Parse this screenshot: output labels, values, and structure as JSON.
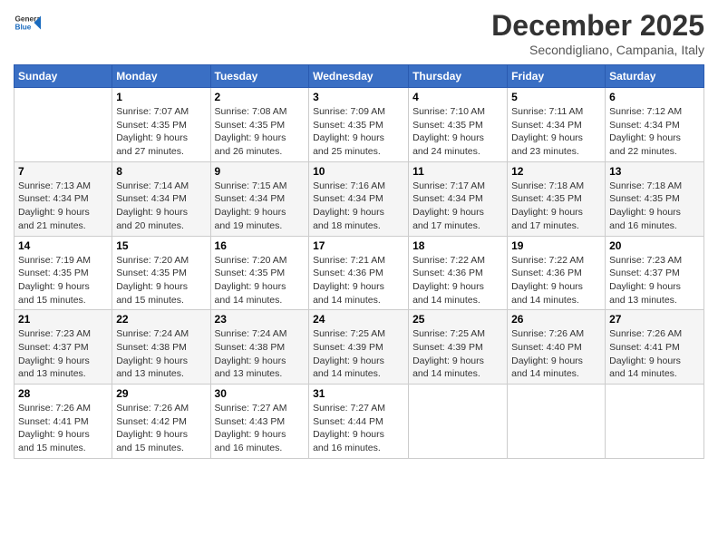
{
  "logo": {
    "general": "General",
    "blue": "Blue"
  },
  "header": {
    "month": "December 2025",
    "location": "Secondigliano, Campania, Italy"
  },
  "weekdays": [
    "Sunday",
    "Monday",
    "Tuesday",
    "Wednesday",
    "Thursday",
    "Friday",
    "Saturday"
  ],
  "weeks": [
    [
      {
        "day": "",
        "info": ""
      },
      {
        "day": "1",
        "info": "Sunrise: 7:07 AM\nSunset: 4:35 PM\nDaylight: 9 hours\nand 27 minutes."
      },
      {
        "day": "2",
        "info": "Sunrise: 7:08 AM\nSunset: 4:35 PM\nDaylight: 9 hours\nand 26 minutes."
      },
      {
        "day": "3",
        "info": "Sunrise: 7:09 AM\nSunset: 4:35 PM\nDaylight: 9 hours\nand 25 minutes."
      },
      {
        "day": "4",
        "info": "Sunrise: 7:10 AM\nSunset: 4:35 PM\nDaylight: 9 hours\nand 24 minutes."
      },
      {
        "day": "5",
        "info": "Sunrise: 7:11 AM\nSunset: 4:34 PM\nDaylight: 9 hours\nand 23 minutes."
      },
      {
        "day": "6",
        "info": "Sunrise: 7:12 AM\nSunset: 4:34 PM\nDaylight: 9 hours\nand 22 minutes."
      }
    ],
    [
      {
        "day": "7",
        "info": "Sunrise: 7:13 AM\nSunset: 4:34 PM\nDaylight: 9 hours\nand 21 minutes."
      },
      {
        "day": "8",
        "info": "Sunrise: 7:14 AM\nSunset: 4:34 PM\nDaylight: 9 hours\nand 20 minutes."
      },
      {
        "day": "9",
        "info": "Sunrise: 7:15 AM\nSunset: 4:34 PM\nDaylight: 9 hours\nand 19 minutes."
      },
      {
        "day": "10",
        "info": "Sunrise: 7:16 AM\nSunset: 4:34 PM\nDaylight: 9 hours\nand 18 minutes."
      },
      {
        "day": "11",
        "info": "Sunrise: 7:17 AM\nSunset: 4:34 PM\nDaylight: 9 hours\nand 17 minutes."
      },
      {
        "day": "12",
        "info": "Sunrise: 7:18 AM\nSunset: 4:35 PM\nDaylight: 9 hours\nand 17 minutes."
      },
      {
        "day": "13",
        "info": "Sunrise: 7:18 AM\nSunset: 4:35 PM\nDaylight: 9 hours\nand 16 minutes."
      }
    ],
    [
      {
        "day": "14",
        "info": "Sunrise: 7:19 AM\nSunset: 4:35 PM\nDaylight: 9 hours\nand 15 minutes."
      },
      {
        "day": "15",
        "info": "Sunrise: 7:20 AM\nSunset: 4:35 PM\nDaylight: 9 hours\nand 15 minutes."
      },
      {
        "day": "16",
        "info": "Sunrise: 7:20 AM\nSunset: 4:35 PM\nDaylight: 9 hours\nand 14 minutes."
      },
      {
        "day": "17",
        "info": "Sunrise: 7:21 AM\nSunset: 4:36 PM\nDaylight: 9 hours\nand 14 minutes."
      },
      {
        "day": "18",
        "info": "Sunrise: 7:22 AM\nSunset: 4:36 PM\nDaylight: 9 hours\nand 14 minutes."
      },
      {
        "day": "19",
        "info": "Sunrise: 7:22 AM\nSunset: 4:36 PM\nDaylight: 9 hours\nand 14 minutes."
      },
      {
        "day": "20",
        "info": "Sunrise: 7:23 AM\nSunset: 4:37 PM\nDaylight: 9 hours\nand 13 minutes."
      }
    ],
    [
      {
        "day": "21",
        "info": "Sunrise: 7:23 AM\nSunset: 4:37 PM\nDaylight: 9 hours\nand 13 minutes."
      },
      {
        "day": "22",
        "info": "Sunrise: 7:24 AM\nSunset: 4:38 PM\nDaylight: 9 hours\nand 13 minutes."
      },
      {
        "day": "23",
        "info": "Sunrise: 7:24 AM\nSunset: 4:38 PM\nDaylight: 9 hours\nand 13 minutes."
      },
      {
        "day": "24",
        "info": "Sunrise: 7:25 AM\nSunset: 4:39 PM\nDaylight: 9 hours\nand 14 minutes."
      },
      {
        "day": "25",
        "info": "Sunrise: 7:25 AM\nSunset: 4:39 PM\nDaylight: 9 hours\nand 14 minutes."
      },
      {
        "day": "26",
        "info": "Sunrise: 7:26 AM\nSunset: 4:40 PM\nDaylight: 9 hours\nand 14 minutes."
      },
      {
        "day": "27",
        "info": "Sunrise: 7:26 AM\nSunset: 4:41 PM\nDaylight: 9 hours\nand 14 minutes."
      }
    ],
    [
      {
        "day": "28",
        "info": "Sunrise: 7:26 AM\nSunset: 4:41 PM\nDaylight: 9 hours\nand 15 minutes."
      },
      {
        "day": "29",
        "info": "Sunrise: 7:26 AM\nSunset: 4:42 PM\nDaylight: 9 hours\nand 15 minutes."
      },
      {
        "day": "30",
        "info": "Sunrise: 7:27 AM\nSunset: 4:43 PM\nDaylight: 9 hours\nand 16 minutes."
      },
      {
        "day": "31",
        "info": "Sunrise: 7:27 AM\nSunset: 4:44 PM\nDaylight: 9 hours\nand 16 minutes."
      },
      {
        "day": "",
        "info": ""
      },
      {
        "day": "",
        "info": ""
      },
      {
        "day": "",
        "info": ""
      }
    ]
  ]
}
